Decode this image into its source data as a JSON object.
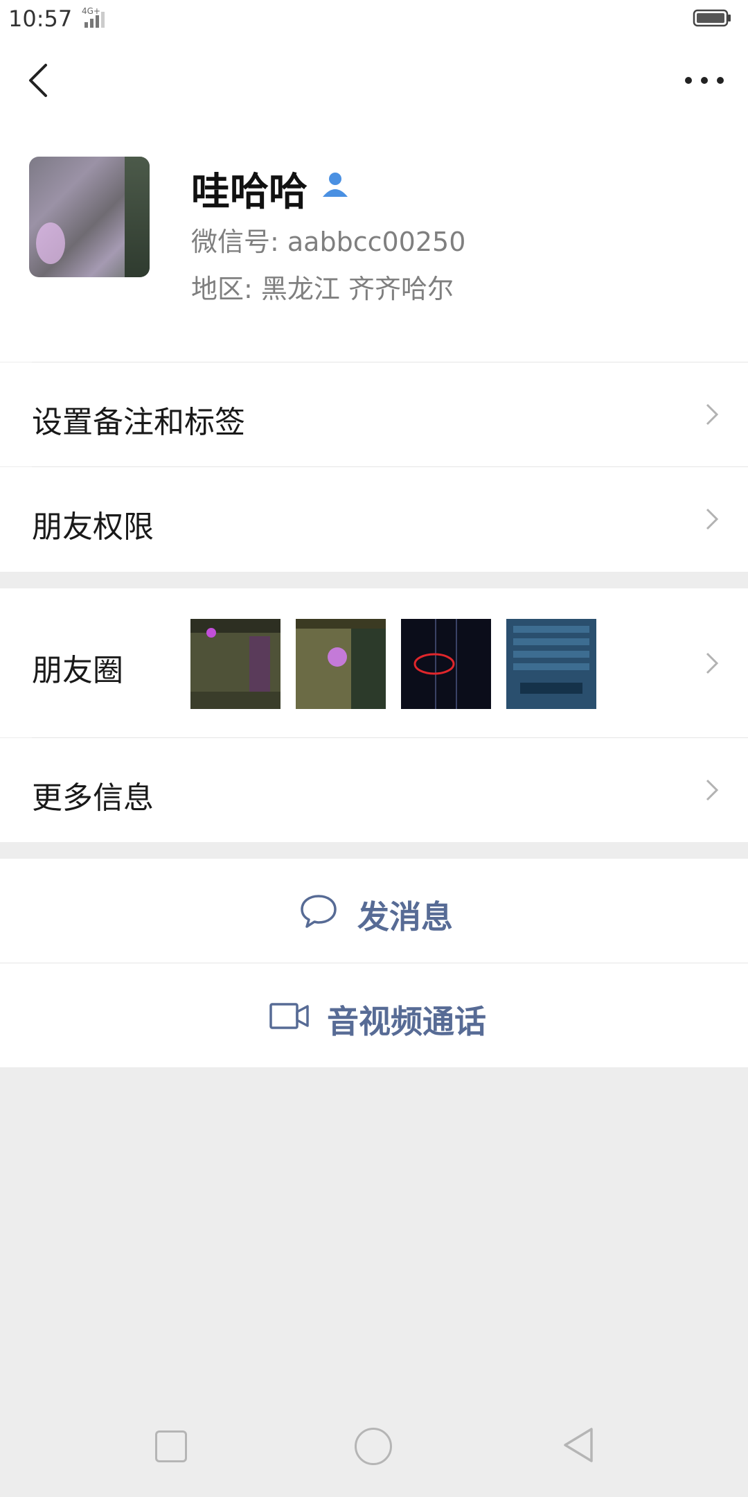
{
  "status_bar": {
    "time": "10:57",
    "network": "4G+"
  },
  "profile": {
    "name": "哇哈哈",
    "wechat_id": "微信号: aabbcc00250",
    "region": "地区: 黑龙江  齐齐哈尔"
  },
  "rows": {
    "remarks": "设置备注和标签",
    "permissions": "朋友权限",
    "moments": "朋友圈",
    "more_info": "更多信息"
  },
  "actions": {
    "message": "发消息",
    "video_call": "音视频通话"
  },
  "colors": {
    "link": "#576b95",
    "verified": "#4a90e2"
  }
}
